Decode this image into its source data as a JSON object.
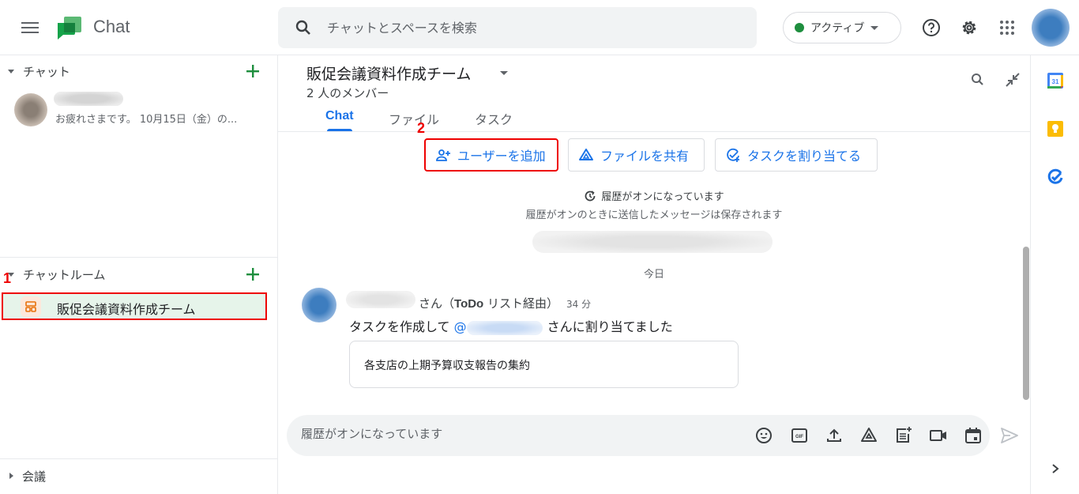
{
  "app": {
    "title": "Chat"
  },
  "search": {
    "placeholder": "チャットとスペースを検索"
  },
  "status": {
    "label": "アクティブ",
    "color": "#1e8e3e"
  },
  "top_icons": [
    "help-icon",
    "settings-icon",
    "apps-grid-icon"
  ],
  "sidebar": {
    "chat_section": {
      "title": "チャット",
      "items": [
        {
          "snippet": "お疲れさまです。 10月15日（金）の..."
        }
      ]
    },
    "rooms_section": {
      "title": "チャットルーム",
      "items": [
        {
          "name": "販促会議資料作成チーム",
          "selected": true
        }
      ]
    },
    "meetings_section": {
      "title": "会議"
    }
  },
  "annotations": {
    "step1": "1",
    "step2": "2"
  },
  "room": {
    "title": "販促会議資料作成チーム",
    "members": "2 人のメンバー",
    "tabs": [
      {
        "label": "Chat",
        "active": true
      },
      {
        "label": "ファイル",
        "active": false
      },
      {
        "label": "タスク",
        "active": false
      }
    ],
    "actions": {
      "add_user": "ユーザーを追加",
      "share_file": "ファイルを共有",
      "assign_task": "タスクを割り当てる"
    },
    "history": {
      "title": "履歴がオンになっています",
      "subtitle": "履歴がオンのときに送信したメッセージは保存されます"
    },
    "date_divider": "今日",
    "message": {
      "sender_suffix": "さん（",
      "via": "ToDo",
      "via_suffix": " リスト経由）",
      "time": "34 分",
      "text_prefix": "タスクを作成して ",
      "mention_at": "@",
      "text_suffix": "さんに割り当てました",
      "task_title": "各支店の上期予算収支報告の集約"
    },
    "composer": {
      "placeholder": "履歴がオンになっています",
      "tools": [
        "emoji-icon",
        "gif-icon",
        "upload-icon",
        "drive-icon",
        "create-doc-icon",
        "video-meeting-icon",
        "calendar-event-icon"
      ]
    }
  },
  "rail": {
    "apps": [
      "google-calendar-icon",
      "google-keep-icon",
      "google-tasks-icon"
    ]
  }
}
